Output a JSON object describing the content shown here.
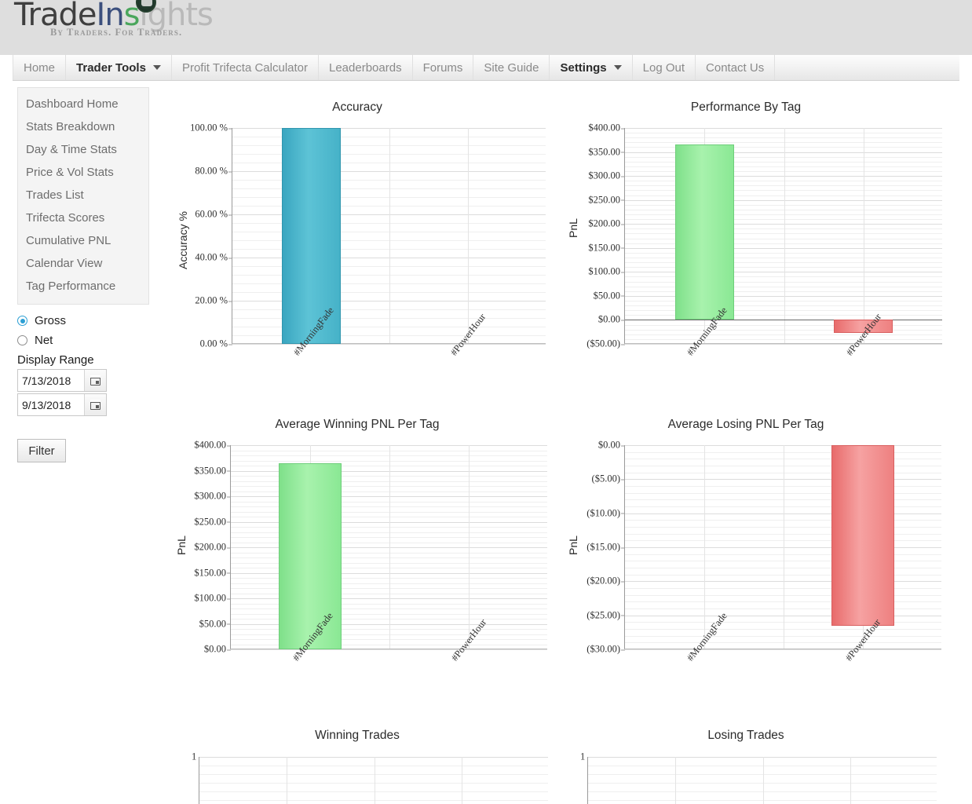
{
  "brand": {
    "logo_trade": "Trade",
    "logo_in": "In",
    "logo_s": "s",
    "logo_ights": "ights",
    "tagline": "By Traders. For Traders."
  },
  "nav": {
    "items": [
      {
        "label": "Home",
        "active": false,
        "caret": false
      },
      {
        "label": "Trader Tools",
        "active": true,
        "caret": true
      },
      {
        "label": "Profit Trifecta Calculator",
        "active": false,
        "caret": false
      },
      {
        "label": "Leaderboards",
        "active": false,
        "caret": false
      },
      {
        "label": "Forums",
        "active": false,
        "caret": false
      },
      {
        "label": "Site Guide",
        "active": false,
        "caret": false
      },
      {
        "label": "Settings",
        "active": true,
        "caret": true
      },
      {
        "label": "Log Out",
        "active": false,
        "caret": false
      },
      {
        "label": "Contact Us",
        "active": false,
        "caret": false
      }
    ]
  },
  "sidebar": {
    "items": [
      {
        "label": "Dashboard Home"
      },
      {
        "label": "Stats Breakdown"
      },
      {
        "label": "Day & Time Stats"
      },
      {
        "label": "Price & Vol Stats"
      },
      {
        "label": "Trades List"
      },
      {
        "label": "Trifecta Scores"
      },
      {
        "label": "Cumulative PNL"
      },
      {
        "label": "Calendar View"
      },
      {
        "label": "Tag Performance"
      }
    ]
  },
  "controls": {
    "gross_label": "Gross",
    "net_label": "Net",
    "gross_selected": true,
    "net_selected": false,
    "range_label": "Display Range",
    "start_date": "7/13/2018",
    "end_date": "9/13/2018",
    "filter_label": "Filter",
    "calendar_icon": "calendar-icon"
  },
  "chart_data": [
    {
      "type": "bar",
      "title": "Accuracy",
      "xlabel": "",
      "ylabel": "Accuracy %",
      "categories": [
        "#MorningFade",
        "#PowerHour"
      ],
      "values": [
        100.0,
        0.0
      ],
      "colors": [
        "#46b2c8",
        "#46b2c8"
      ],
      "ylim": [
        0,
        100
      ],
      "yticks": [
        "0.00 %",
        "20.00 %",
        "40.00 %",
        "60.00 %",
        "80.00 %",
        "100.00 %"
      ],
      "ytick_values": [
        0,
        20,
        40,
        60,
        80,
        100
      ],
      "grid": true,
      "legend": "none"
    },
    {
      "type": "bar",
      "title": "Performance By Tag",
      "xlabel": "",
      "ylabel": "PnL",
      "categories": [
        "#MorningFade",
        "#PowerHour"
      ],
      "values": [
        366.0,
        -26.5
      ],
      "colors": [
        "#8ae894",
        "#ee8080"
      ],
      "ylim": [
        -50,
        400
      ],
      "yticks": [
        "($50.00)",
        "$0.00",
        "$50.00",
        "$100.00",
        "$150.00",
        "$200.00",
        "$250.00",
        "$300.00",
        "$350.00",
        "$400.00"
      ],
      "ytick_values": [
        -50,
        0,
        50,
        100,
        150,
        200,
        250,
        300,
        350,
        400
      ],
      "grid": true,
      "legend": "none"
    },
    {
      "type": "bar",
      "title": "Average Winning PNL Per Tag",
      "xlabel": "",
      "ylabel": "PnL",
      "categories": [
        "#MorningFade",
        "#PowerHour"
      ],
      "values": [
        365.0,
        0.0
      ],
      "colors": [
        "#8ae894",
        "#8ae894"
      ],
      "ylim": [
        0,
        400
      ],
      "yticks": [
        "$0.00",
        "$50.00",
        "$100.00",
        "$150.00",
        "$200.00",
        "$250.00",
        "$300.00",
        "$350.00",
        "$400.00"
      ],
      "ytick_values": [
        0,
        50,
        100,
        150,
        200,
        250,
        300,
        350,
        400
      ],
      "grid": true,
      "legend": "none"
    },
    {
      "type": "bar",
      "title": "Average Losing PNL Per Tag",
      "xlabel": "",
      "ylabel": "PnL",
      "categories": [
        "#MorningFade",
        "#PowerHour"
      ],
      "values": [
        0.0,
        -26.5
      ],
      "colors": [
        "#ee8080",
        "#ee8080"
      ],
      "ylim": [
        -30,
        0
      ],
      "yticks": [
        "$0.00",
        "($5.00)",
        "($10.00)",
        "($15.00)",
        "($20.00)",
        "($25.00)",
        "($30.00)"
      ],
      "ytick_values": [
        0,
        -5,
        -10,
        -15,
        -20,
        -25,
        -30
      ],
      "grid": true,
      "legend": "none"
    },
    {
      "type": "bar",
      "title": "Winning Trades",
      "xlabel": "",
      "ylabel": "",
      "categories": [],
      "values": [],
      "ylim": [
        0,
        1
      ],
      "yticks": [
        "1"
      ],
      "ytick_values": [
        1
      ],
      "grid": true,
      "legend": "none",
      "note": "clipped at bottom of viewport"
    },
    {
      "type": "bar",
      "title": "Losing Trades",
      "xlabel": "",
      "ylabel": "",
      "categories": [],
      "values": [],
      "ylim": [
        0,
        1
      ],
      "yticks": [
        "1"
      ],
      "ytick_values": [
        1
      ],
      "grid": true,
      "legend": "none",
      "note": "clipped at bottom of viewport"
    }
  ]
}
